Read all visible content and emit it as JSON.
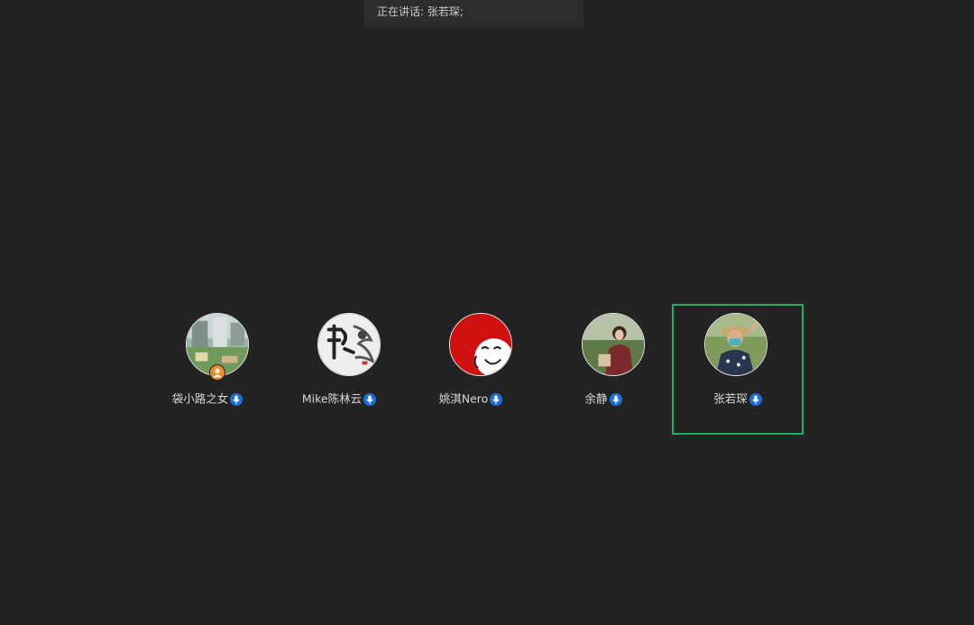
{
  "speaking_bar": {
    "text": "正在讲话: 张若琛;"
  },
  "colors": {
    "background": "#232323",
    "active_border": "#1fad5f",
    "mic_badge": "#1e6fd9",
    "host_badge": "#f08a24"
  },
  "participants": [
    {
      "name": "袋小路之女",
      "avatar_icon": "photo-avatar",
      "mic": "mic-icon",
      "host": true,
      "active": false
    },
    {
      "name": "Mike陈林云",
      "avatar_icon": "calligraphy-avatar",
      "mic": "mic-icon",
      "host": false,
      "active": false
    },
    {
      "name": "姚淇Nero",
      "avatar_icon": "cartoon-face-avatar",
      "mic": "mic-icon",
      "host": false,
      "active": false
    },
    {
      "name": "余静",
      "avatar_icon": "photo-avatar",
      "mic": "mic-icon",
      "host": false,
      "active": false
    },
    {
      "name": "张若琛",
      "avatar_icon": "photo-avatar",
      "mic": "mic-icon",
      "host": false,
      "active": true
    }
  ]
}
